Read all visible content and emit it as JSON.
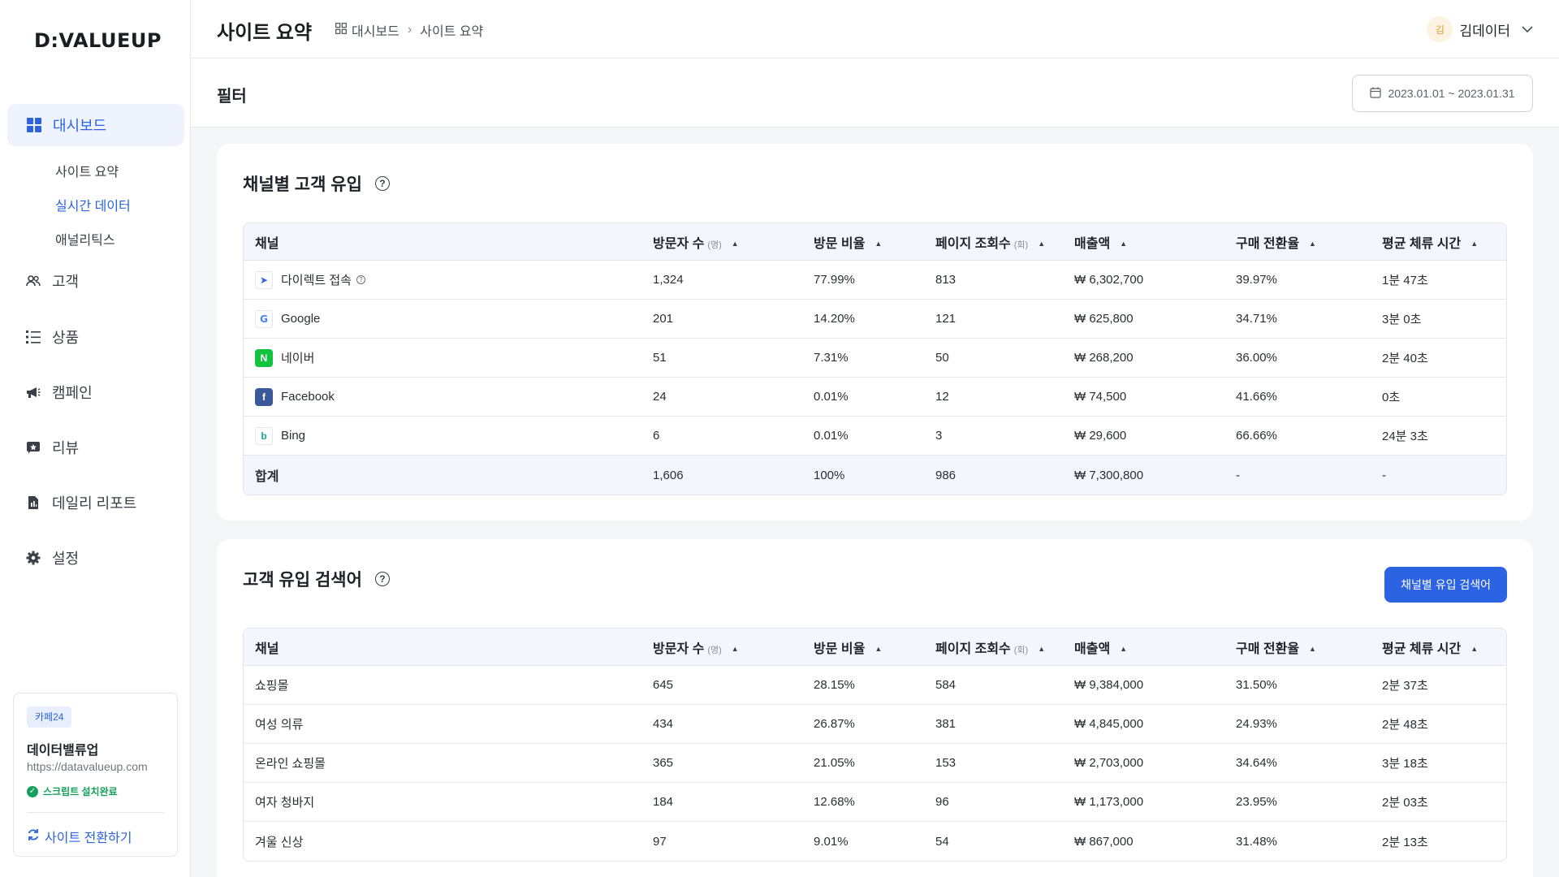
{
  "brand": {
    "logo": "D:VALUEUP"
  },
  "sidebar": {
    "active": {
      "label": "대시보드"
    },
    "subitems": [
      "사이트 요약",
      "실시간 데이터",
      "애널리틱스"
    ],
    "items": [
      {
        "label": "고객",
        "icon": "users-icon"
      },
      {
        "label": "상품",
        "icon": "list-icon"
      },
      {
        "label": "캠페인",
        "icon": "megaphone-icon"
      },
      {
        "label": "리뷰",
        "icon": "review-icon"
      },
      {
        "label": "데일리 리포트",
        "icon": "report-icon"
      },
      {
        "label": "설정",
        "icon": "gear-icon"
      }
    ],
    "site": {
      "badge": "카페24",
      "name": "데이터밸류업",
      "url": "https://datavalueup.com",
      "status": "스크립트 설치완료",
      "switch_label": "사이트 전환하기"
    }
  },
  "header": {
    "title": "사이트 요약",
    "breadcrumb": [
      "대시보드",
      "사이트 요약"
    ],
    "user": {
      "avatar": "김",
      "name": "김데이터"
    }
  },
  "filter": {
    "title": "필터",
    "date_range": "2023.01.01  ~  2023.01.31"
  },
  "channels": {
    "title": "채널별 고객 유입",
    "headers": [
      "채널",
      "방문자 수",
      "방문 비율",
      "페이지 조회수",
      "매출액",
      "구매 전환율",
      "평균 체류 시간"
    ],
    "units": {
      "visitors": "(명)",
      "pageviews": "(회)"
    },
    "rows": [
      [
        "다이렉트 접속",
        "1,324",
        "77.99%",
        "813",
        "₩ 6,302,700",
        "39.97%",
        "1분 47초"
      ],
      [
        "Google",
        "201",
        "14.20%",
        "121",
        "₩ 625,800",
        "34.71%",
        "3분 0초"
      ],
      [
        "네이버",
        "51",
        "7.31%",
        "50",
        "₩ 268,200",
        "36.00%",
        "2분 40초"
      ],
      [
        "Facebook",
        "24",
        "0.01%",
        "12",
        "₩ 74,500",
        "41.66%",
        "0초"
      ],
      [
        "Bing",
        "6",
        "0.01%",
        "3",
        "₩ 29,600",
        "66.66%",
        "24분 3초"
      ]
    ],
    "total": [
      "합계",
      "1,606",
      "100%",
      "986",
      "₩ 7,300,800",
      "-",
      "-"
    ]
  },
  "keywords": {
    "title": "고객 유입 검색어",
    "button": "채널별 유입 검색어",
    "headers": [
      "채널",
      "방문자 수",
      "방문 비율",
      "페이지 조회수",
      "매출액",
      "구매 전환율",
      "평균 체류 시간"
    ],
    "rows": [
      [
        "쇼핑몰",
        "645",
        "28.15%",
        "584",
        "₩ 9,384,000",
        "31.50%",
        "2분 37초"
      ],
      [
        "여성 의류",
        "434",
        "26.87%",
        "381",
        "₩ 4,845,000",
        "24.93%",
        "2분 48초"
      ],
      [
        "온라인 쇼핑몰",
        "365",
        "21.05%",
        "153",
        "₩ 2,703,000",
        "34.64%",
        "3분 18초"
      ],
      [
        "여자 청바지",
        "184",
        "12.68%",
        "96",
        "₩ 1,173,000",
        "23.95%",
        "2분 03초"
      ],
      [
        "겨울 신상",
        "97",
        "9.01%",
        "54",
        "₩ 867,000",
        "31.48%",
        "2분 13초"
      ]
    ]
  }
}
